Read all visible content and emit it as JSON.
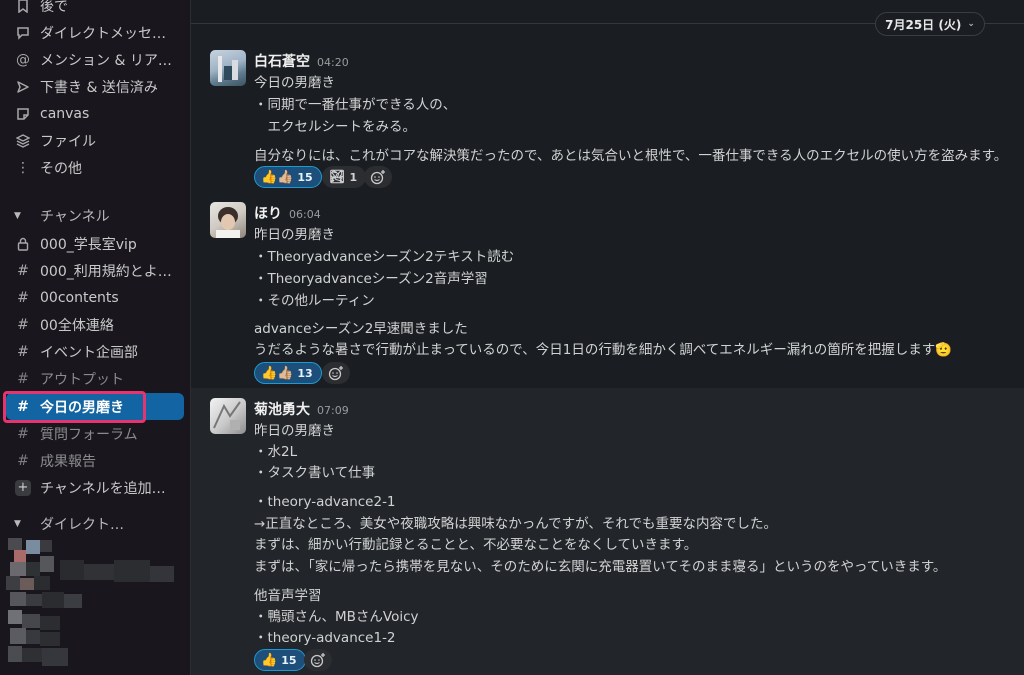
{
  "sidebar": {
    "nav": [
      {
        "label": "後で",
        "icon": "bookmark-icon"
      },
      {
        "label": "ダイレクトメッセ…",
        "icon": "dm-icon"
      },
      {
        "label": "メンション & リア…",
        "icon": "at-icon"
      },
      {
        "label": "下書き & 送信済み",
        "icon": "send-icon"
      },
      {
        "label": "canvas",
        "icon": "canvas-icon"
      },
      {
        "label": "ファイル",
        "icon": "files-icon"
      },
      {
        "label": "その他",
        "icon": "more-icon"
      }
    ],
    "channels_header": "チャンネル",
    "channels": [
      {
        "label": "000_学長室vip",
        "icon": "lock-icon"
      },
      {
        "label": "000_利用規約とよ…",
        "icon": "hash-icon"
      },
      {
        "label": "00contents",
        "icon": "hash-icon"
      },
      {
        "label": "00全体連絡",
        "icon": "hash-icon"
      },
      {
        "label": "イベント企画部",
        "icon": "hash-icon"
      },
      {
        "label": "アウトプット",
        "icon": "hash-icon"
      },
      {
        "label": "今日の男磨き",
        "icon": "hash-icon",
        "active": true
      },
      {
        "label": "質問フォーラム",
        "icon": "hash-icon"
      },
      {
        "label": "成果報告",
        "icon": "hash-icon"
      }
    ],
    "add_channel": "チャンネルを追加…",
    "dm_header": "ダイレクト…",
    "accent_color": "#1264a3",
    "highlight_color": "#e5346f"
  },
  "main": {
    "date_label": "7月25日 (火)",
    "messages": [
      {
        "author": "白石蒼空",
        "time": "04:20",
        "lines": [
          "今日の男磨き",
          "・同期で一番仕事ができる人の、",
          "　エクセルシートをみる。",
          "自分なりには、これがコアな解決策だったので、あとは気合いと根性で、一番仕事できる人のエクセルの使い方を盗みます。"
        ],
        "reactions": [
          {
            "emoji": "👍👍🏼",
            "count": "15",
            "mine": true
          },
          {
            "emoji": "🏞",
            "count": "1",
            "mine": false
          }
        ]
      },
      {
        "author": "ほり",
        "time": "06:04",
        "lines": [
          "昨日の男磨き",
          "・Theoryadvanceシーズン2テキスト読む",
          "・Theoryadvanceシーズン2音声学習",
          "・その他ルーティン",
          "advanceシーズン2早速聞きました",
          "うだるような暑さで行動が止まっているので、今日1日の行動を細かく調べてエネルギー漏れの箇所を把握します🫡"
        ],
        "reactions": [
          {
            "emoji": "👍👍🏼",
            "count": "13",
            "mine": true
          }
        ]
      },
      {
        "author": "菊池勇大",
        "time": "07:09",
        "lines": [
          "昨日の男磨き",
          "・水2L",
          "・タスク書いて仕事",
          "・theory-advance2-1",
          "→正直なところ、美女や夜職攻略は興味なかっんですが、それでも重要な内容でした。",
          "まずは、細かい行動記録とることと、不必要なことをなくしていきます。",
          "まずは、「家に帰ったら携帯を見ない、そのために玄関に充電器置いてそのまま寝る」というのをやっていきます。",
          "他音声学習",
          "・鴨頭さん、MBさんVoicy",
          "・theory-advance1-2"
        ],
        "reactions": [
          {
            "emoji": "👍",
            "count": "15",
            "mine": true
          }
        ]
      }
    ]
  }
}
